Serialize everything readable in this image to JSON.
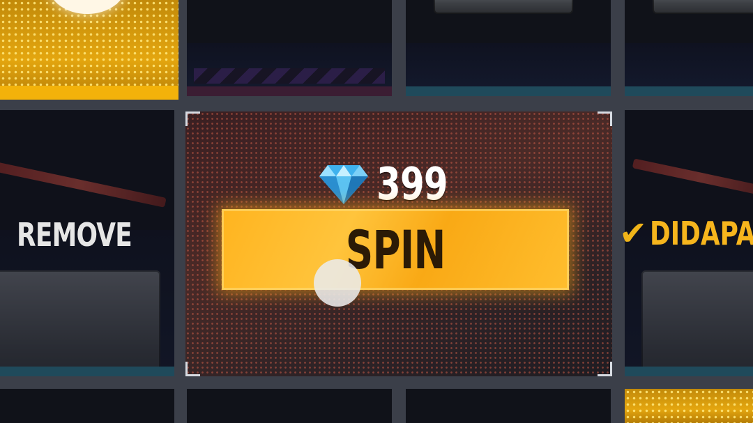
{
  "spin_card": {
    "currency_icon": "diamond-icon",
    "price": "399",
    "spin_label": "SPIN"
  },
  "left_card": {
    "action_label": "REMOVE"
  },
  "right_card": {
    "status_icon": "checkmark-icon",
    "status_label": "DIDAPA"
  },
  "colors": {
    "spin_button": "#ffb41f",
    "selected_gold": "#f3b20a",
    "status_yellow": "#f6b51d"
  }
}
